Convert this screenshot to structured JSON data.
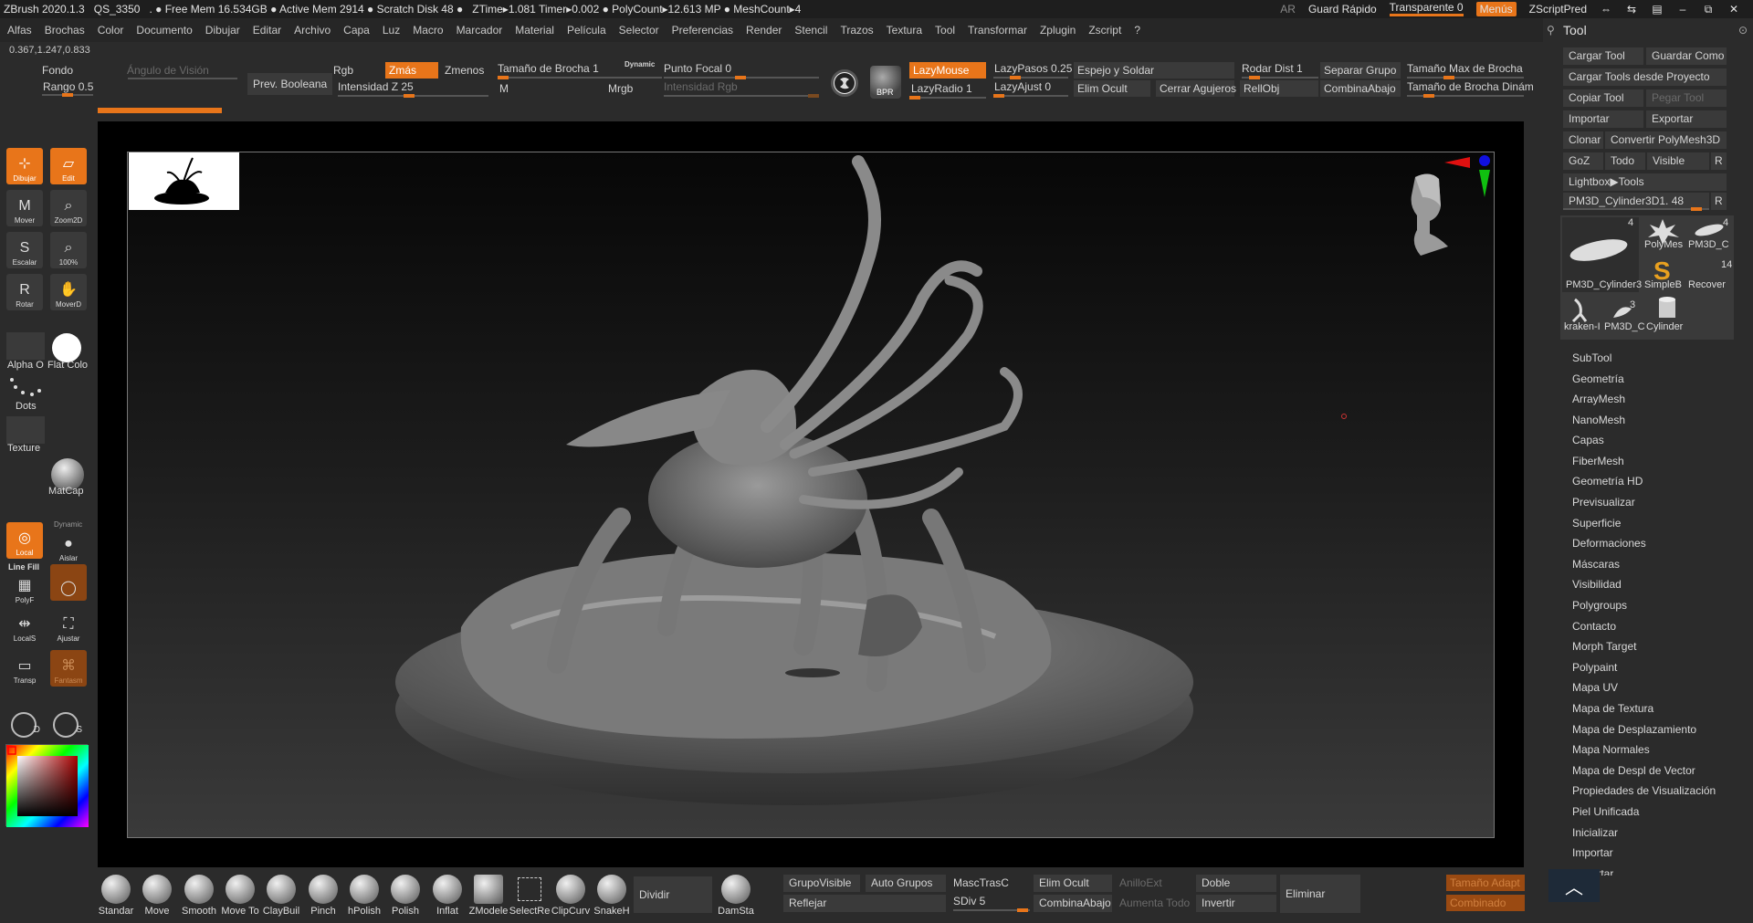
{
  "titlebar": {
    "app": "ZBrush 2020.1.3",
    "doc": "QS_3350",
    "stats": ". ● Free Mem 16.534GB ● Active Mem 2914 ● Scratch Disk 48 ●",
    "ztime": "ZTime▸1.081 Timer▸0.002 ● PolyCount▸12.613 MP ● MeshCount▸4",
    "ar": "AR",
    "quicksave": "Guard Rápido",
    "transparent": "Transparente 0",
    "menus": "Menús",
    "zscriptpred": "ZScriptPred"
  },
  "menubar": [
    "Alfas",
    "Brochas",
    "Color",
    "Documento",
    "Dibujar",
    "Editar",
    "Archivo",
    "Capa",
    "Luz",
    "Macro",
    "Marcador",
    "Material",
    "Película",
    "Selector",
    "Preferencias",
    "Render",
    "Stencil",
    "Trazos",
    "Textura",
    "Tool",
    "Transformar",
    "Zplugin",
    "Zscript",
    "?"
  ],
  "coords": "0.367,1.247,0.833",
  "shelf": {
    "fondo": "Fondo",
    "angulo": "Ángulo de Visión",
    "rango": "Rango 0.5",
    "prev_booleana": "Prev. Booleana",
    "rgb": "Rgb",
    "zmas": "Zmás",
    "zmenos": "Zmenos",
    "intensidad_z": "Intensidad Z 25",
    "m": "M",
    "tamano_brocha": "Tamaño de Brocha 1",
    "dynamic": "Dynamic",
    "mrgb": "Mrgb",
    "punto_focal": "Punto Focal 0",
    "intensidad_rgb": "Intensidad Rgb",
    "bpr": "BPR",
    "lazymouse": "LazyMouse",
    "lazyradio": "LazyRadio 1",
    "lazypasos": "LazyPasos 0.25",
    "lazyajust": "LazyAjust 0",
    "espejo": "Espejo y Soldar",
    "elim_ocult": "Elim Ocult",
    "cerrar_agujeros": "Cerrar Agujeros",
    "rodar_dist": "Rodar Dist 1",
    "rellobj": "RellObj",
    "separar_grupo": "Separar Grupo",
    "combina_abajo": "CombinaAbajo",
    "tam_max": "Tamaño Max de Brocha",
    "tam_dinamico": "Tamaño de Brocha Dinám"
  },
  "left_tray": {
    "dibujar": "Dibujar",
    "edit": "Edit",
    "mover": "Mover",
    "zoom2d": "Zoom2D",
    "escalar": "Escalar",
    "pct100": "100%",
    "rotar": "Rotar",
    "moverd": "MoverD",
    "alpha": "Alpha O",
    "flat_color": "Flat Colo",
    "dots": "Dots",
    "texture": "Texture",
    "matcap": "MatCap",
    "local": "Local",
    "dynamic": "Dynamic",
    "aislar": "Aislar",
    "line_fill": "Line Fill",
    "polyf": "PolyF",
    "locals": "LocalS",
    "ajustar": "Ajustar",
    "transp": "Transp",
    "fantasma": "Fantasm",
    "d": "D",
    "s": "S"
  },
  "brushes": [
    "Standar",
    "Move",
    "Smooth",
    "Move To",
    "ClayBuil",
    "Pinch",
    "hPolish",
    "Polish",
    "Inflat",
    "ZModele",
    "SelectRe",
    "ClipCurv",
    "SnakeH"
  ],
  "bottom": {
    "dividir": "Dividir",
    "damsta": "DamSta",
    "grupo_visible": "GrupoVisible",
    "auto_grupos": "Auto Grupos",
    "reflejar": "Reflejar",
    "masc_trasc": "MascTrasC",
    "sdiv": "SDiv 5",
    "elim_ocult": "Elim Ocult",
    "combina_abajo": "CombinaAbajo",
    "anillo_ext": "AnilloExt",
    "aumenta_todo": "Aumenta Todo",
    "doble": "Doble",
    "invertir": "Invertir",
    "eliminar": "Eliminar",
    "tamano_adapt": "Tamaño Adapt",
    "combinado": "Combinado"
  },
  "tool_panel": {
    "title": "Tool",
    "cargar_tool": "Cargar Tool",
    "guardar_como": "Guardar Como",
    "cargar_proyecto": "Cargar Tools desde Proyecto",
    "copiar_tool": "Copiar Tool",
    "pegar_tool": "Pegar Tool",
    "importar": "Importar",
    "exportar": "Exportar",
    "clonar": "Clonar",
    "convertir": "Convertir PolyMesh3D",
    "goz": "GoZ",
    "todo": "Todo",
    "visible": "Visible",
    "r": "R",
    "lightbox": "Lightbox▶Tools",
    "current_tool": "PM3D_Cylinder3D1. 48",
    "r2": "R",
    "cells": {
      "cyl_count": "4",
      "cyl_label": "PM3D_Cylinder3",
      "polymesh": "PolyMes",
      "pm3dc": "PM3D_C",
      "pm3dc_count": "4",
      "simpleb": "SimpleB",
      "recover": "Recover",
      "recover_count": "14",
      "kraken": "kraken-I",
      "pm3dc2": "PM3D_C",
      "pm3dc2_count": "3",
      "cylinder": "Cylinder"
    },
    "items": [
      "SubTool",
      "Geometría",
      "ArrayMesh",
      "NanoMesh",
      "Capas",
      "FiberMesh",
      "Geometría HD",
      "Previsualizar",
      "Superficie",
      "Deformaciones",
      "Máscaras",
      "Visibilidad",
      "Polygroups",
      "Contacto",
      "Morph Target",
      "Polypaint",
      "Mapa UV",
      "Mapa de Textura",
      "Mapa de Desplazamiento",
      "Mapa Normales",
      "Mapa de Despl de Vector",
      "Propiedades de Visualización",
      "Piel Unificada",
      "Inicializar",
      "Importar",
      "Exportar"
    ]
  },
  "colors": {
    "accent": "#e8751a",
    "bg": "#2b2b2b"
  }
}
